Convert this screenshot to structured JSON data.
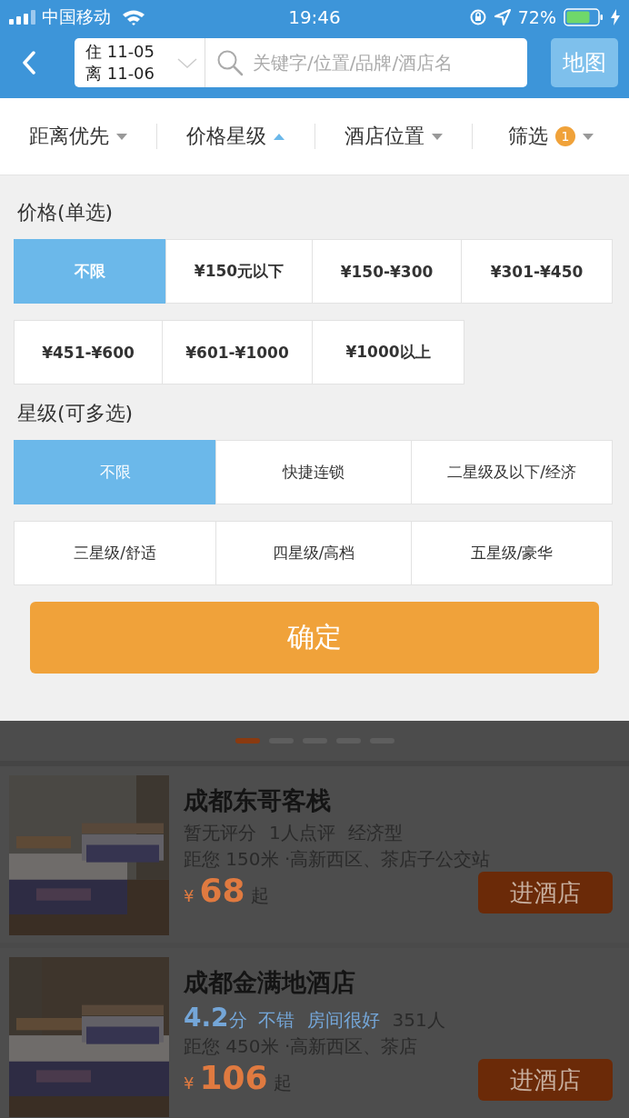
{
  "status_bar": {
    "carrier": "中国移动",
    "time": "19:46",
    "battery": "72%"
  },
  "header": {
    "check_in": "住 11-05",
    "check_out": "离 11-06",
    "search": {
      "placeholder": "关键字/位置/品牌/酒店名"
    },
    "map_button": "地图"
  },
  "sort_tabs": [
    {
      "label": "距离优先",
      "selected": false
    },
    {
      "label": "价格星级",
      "selected": true
    },
    {
      "label": "酒店位置",
      "selected": false
    },
    {
      "label": "筛选",
      "selected": false,
      "badge": "1"
    }
  ],
  "price_section": {
    "title": "价格(单选)",
    "rows": [
      [
        {
          "label": "不限",
          "selected": true
        },
        {
          "label": "¥150元以下",
          "selected": false
        },
        {
          "label": "¥150-¥300",
          "selected": false
        },
        {
          "label": "¥301-¥450",
          "selected": false
        }
      ],
      [
        {
          "label": "¥451-¥600",
          "selected": false
        },
        {
          "label": "¥601-¥1000",
          "selected": false
        },
        {
          "label": "¥1000以上",
          "selected": false
        }
      ]
    ]
  },
  "star_section": {
    "title": "星级(可多选)",
    "rows": [
      [
        {
          "label": "不限",
          "selected": true
        },
        {
          "label": "快捷连锁",
          "selected": false
        },
        {
          "label": "二星级及以下/经济",
          "selected": false
        }
      ],
      [
        {
          "label": "三星级/舒适",
          "selected": false
        },
        {
          "label": "四星级/高档",
          "selected": false
        },
        {
          "label": "五星级/豪华",
          "selected": false
        }
      ]
    ]
  },
  "confirm_button": "确定",
  "pager": [
    {
      "selected": true
    },
    {
      "selected": false
    },
    {
      "selected": false
    },
    {
      "selected": false
    },
    {
      "selected": false
    }
  ],
  "hotels": [
    {
      "name": "成都东哥客栈",
      "rating_line": [
        {
          "kind": "plain",
          "text": "暂无评分"
        },
        {
          "kind": "plain",
          "text": "1人点评"
        },
        {
          "kind": "plain",
          "text": "经济型"
        }
      ],
      "location": "距您 150米 ·高新西区、茶店子公交站",
      "currency": "¥",
      "price": "68",
      "price_suffix": "起",
      "button": "进酒店"
    },
    {
      "name": "成都金满地酒店",
      "rating_line": [
        {
          "kind": "score",
          "text": "4.2"
        },
        {
          "kind": "unit",
          "text": "分"
        },
        {
          "kind": "highlight",
          "text": "不错"
        },
        {
          "kind": "highlight",
          "text": "房间很好"
        },
        {
          "kind": "plain",
          "text": "351人"
        }
      ],
      "location": "距您 450米 ·高新西区、茶店",
      "currency": "¥",
      "price": "106",
      "price_suffix": "起",
      "button": "进酒店"
    }
  ]
}
